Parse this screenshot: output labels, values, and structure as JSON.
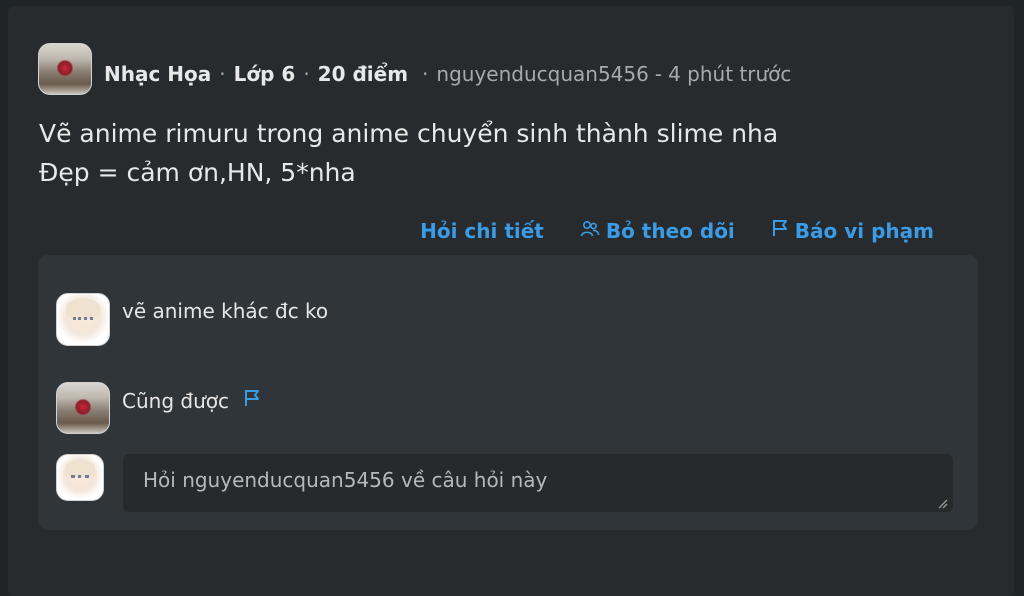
{
  "post": {
    "author": "Nhạc Họa",
    "grade": "Lớp 6",
    "points": "20 điểm",
    "asker": "nguyenducquan5456",
    "separator": "-",
    "time": "4 phút trước",
    "question_line1": "Vẽ anime rimuru trong anime chuyển sinh thành slime nha",
    "question_line2": "Đẹp = cảm ơn,HN, 5*nha"
  },
  "actions": {
    "ask_detail": "Hỏi chi tiết",
    "unfollow": "Bỏ theo dõi",
    "report": "Báo vi phạm"
  },
  "comments": [
    {
      "text": "vẽ anime khác đc ko",
      "avatar": "anime-avatar"
    },
    {
      "text": "Cũng được",
      "avatar": "rose-avatar"
    }
  ],
  "ask_box": {
    "placeholder": "Hỏi nguyenducquan5456 về câu hỏi này"
  },
  "colors": {
    "link": "#3a9be6",
    "card_bg": "#272b2d",
    "panel_bg": "#30353a"
  }
}
